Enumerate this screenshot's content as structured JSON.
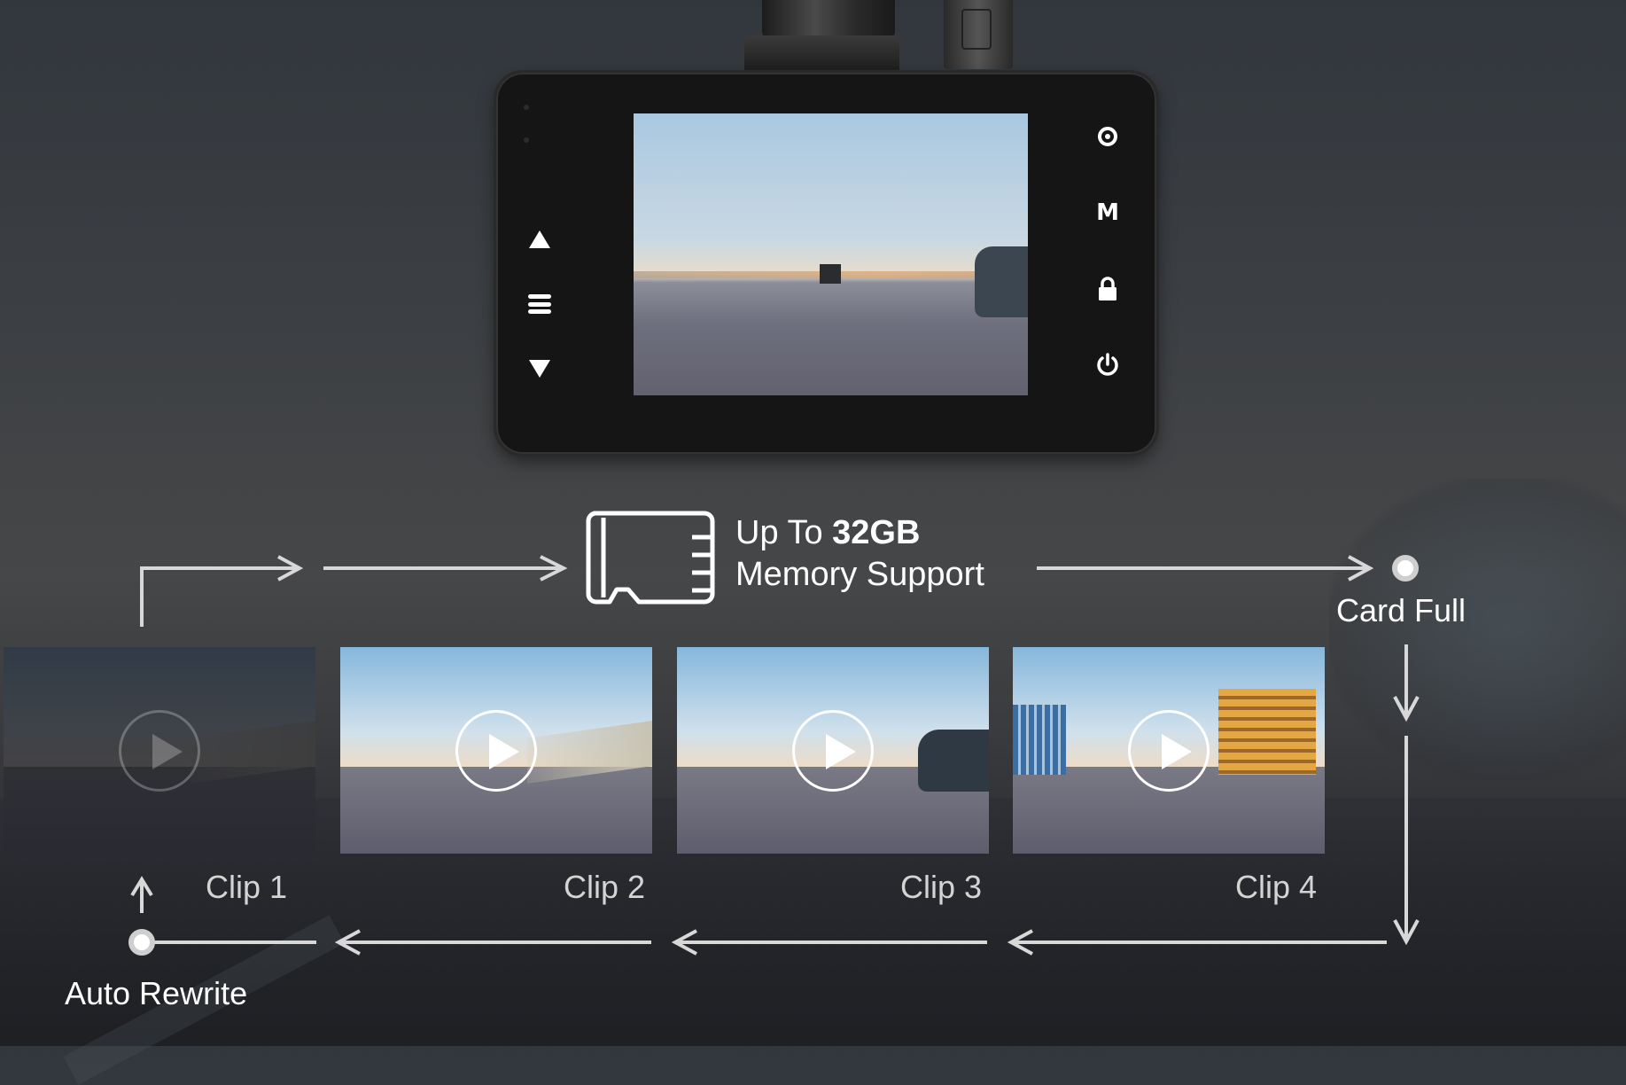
{
  "device": {
    "left_buttons": [
      {
        "id": "up",
        "icon": "triangle-up-icon"
      },
      {
        "id": "menu",
        "icon": "menu-icon"
      },
      {
        "id": "down",
        "icon": "triangle-down-icon"
      }
    ],
    "right_buttons": [
      {
        "id": "record",
        "icon": "record-icon"
      },
      {
        "id": "mode",
        "icon": "mode-icon",
        "label": "M"
      },
      {
        "id": "lock",
        "icon": "lock-icon"
      },
      {
        "id": "power",
        "icon": "power-icon"
      }
    ]
  },
  "memory": {
    "icon": "microsd-card-icon",
    "line1_prefix": "Up To ",
    "line1_bold": "32GB",
    "line2": "Memory Support"
  },
  "flow": {
    "card_full_label": "Card Full",
    "auto_rewrite_label": "Auto Rewrite"
  },
  "clips": [
    {
      "label": "Clip 1",
      "state": "overwritten"
    },
    {
      "label": "Clip 2",
      "state": "recorded"
    },
    {
      "label": "Clip 3",
      "state": "recorded"
    },
    {
      "label": "Clip 4",
      "state": "recorded"
    }
  ],
  "colors": {
    "arrow": "#d8d8d8",
    "text": "#ffffff",
    "clip_label": "#d4d4d4"
  }
}
